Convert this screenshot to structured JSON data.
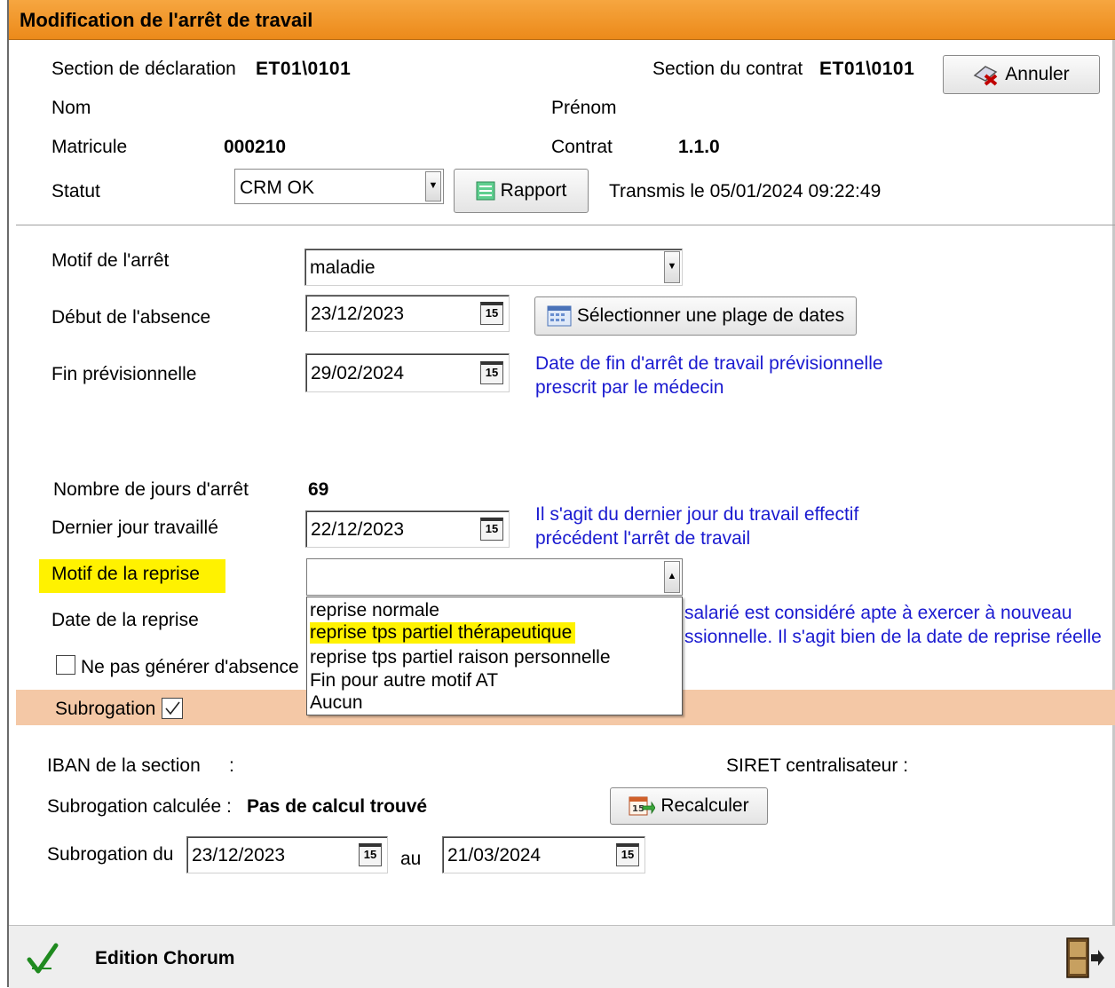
{
  "window": {
    "title": "Modification de l'arrêt de travail"
  },
  "header": {
    "section_declaration_label": "Section de déclaration",
    "section_declaration_value": "ET01\\0101",
    "section_contrat_label": "Section du contrat",
    "section_contrat_value": "ET01\\0101",
    "annuler_label": "Annuler",
    "nom_label": "Nom",
    "prenom_label": "Prénom",
    "matricule_label": "Matricule",
    "matricule_value": "000210",
    "contrat_label": "Contrat",
    "contrat_value": "1.1.0",
    "statut_label": "Statut",
    "statut_value": "CRM OK",
    "rapport_label": "Rapport",
    "transmis_text": "Transmis le 05/01/2024 09:22:49"
  },
  "form": {
    "motif_arret_label": "Motif de l'arrêt",
    "motif_arret_value": "maladie",
    "debut_label": "Début de l'absence",
    "debut_value": "23/12/2023",
    "plage_button": "Sélectionner une plage de dates",
    "fin_label": "Fin prévisionnelle",
    "fin_value": "29/02/2024",
    "fin_help_1": "Date de fin d'arrêt de travail prévisionnelle",
    "fin_help_2": "prescrit par le médecin",
    "nb_jours_label": "Nombre de jours d'arrêt",
    "nb_jours_value": "69",
    "dernier_jour_label": "Dernier jour travaillé",
    "dernier_jour_value": "22/12/2023",
    "dernier_help_1": "Il s'agit du dernier jour du travail effectif",
    "dernier_help_2": "précédent l'arrêt de travail",
    "motif_reprise_label": "Motif de la reprise",
    "motif_reprise_value": "",
    "date_reprise_label": "Date de la reprise",
    "reprise_help_1": "salarié est considéré apte à exercer à nouveau",
    "reprise_help_2": "ssionnelle. Il s'agit bien de la date de reprise réelle",
    "ne_pas_generer_label": "Ne pas générer d'absence",
    "subrogation_label": "Subrogation",
    "reprise_options": [
      "reprise normale",
      "reprise tps partiel thérapeutique",
      "reprise tps partiel raison personnelle",
      "Fin pour autre motif AT",
      "Aucun"
    ]
  },
  "subrogation": {
    "iban_label": "IBAN de la section",
    "iban_colon": ":",
    "siret_label": "SIRET centralisateur :",
    "calculee_label": "Subrogation calculée :",
    "calculee_value": "Pas de calcul trouvé",
    "recalculer_label": "Recalculer",
    "du_label": "Subrogation du",
    "du_value": "23/12/2023",
    "au_label": "au",
    "au_value": "21/03/2024"
  },
  "footer": {
    "edition_label": "Edition Chorum"
  },
  "colors": {
    "title_bar": "#ec8a1a",
    "highlight": "#fff200",
    "band": "#f4c8a6",
    "help_text": "#1a1ad0"
  },
  "icons": [
    "cancel-icon",
    "report-icon",
    "calendar-icon",
    "recalculate-icon",
    "checkmark-icon",
    "exit-door-icon"
  ]
}
